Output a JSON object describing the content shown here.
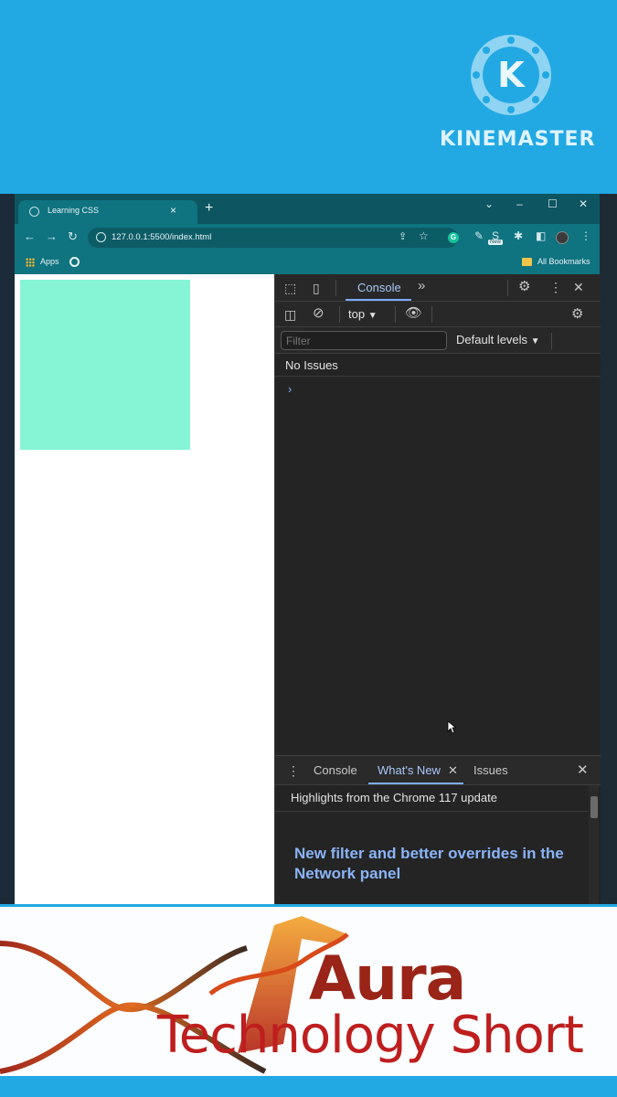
{
  "banner_top": {
    "logo_letter": "K",
    "brand": "KINEMASTER"
  },
  "browser": {
    "tab": {
      "title": "Learning CSS",
      "close": "×"
    },
    "new_tab": "+",
    "window_controls": {
      "dropdown": "⌄",
      "minimize": "–",
      "maximize": "☐",
      "close": "✕"
    },
    "nav": {
      "back": "←",
      "forward": "→",
      "reload": "↻"
    },
    "address": {
      "url": "127.0.0.1:5500/index.html"
    },
    "extensions": {
      "grammarly": "G",
      "new_badge": "New"
    },
    "bookmarks": {
      "apps": "Apps",
      "all_bookmarks": "All Bookmarks"
    }
  },
  "page": {
    "box_color": "#86f5d6"
  },
  "devtools": {
    "main_tab": "Console",
    "more_tabs": "»",
    "context": "top",
    "filter_placeholder": "Filter",
    "levels": "Default levels",
    "issues": "No Issues",
    "prompt": "›",
    "drawer": {
      "tabs": [
        "Console",
        "What's New",
        "Issues"
      ],
      "active_tab_close": "✕",
      "close": "✕",
      "highlights": "Highlights from the Chrome 117 update",
      "headline": "New filter and better overrides in the Network panel"
    }
  },
  "banner_bottom": {
    "line1": "Aura",
    "line2": "Technology Short"
  }
}
